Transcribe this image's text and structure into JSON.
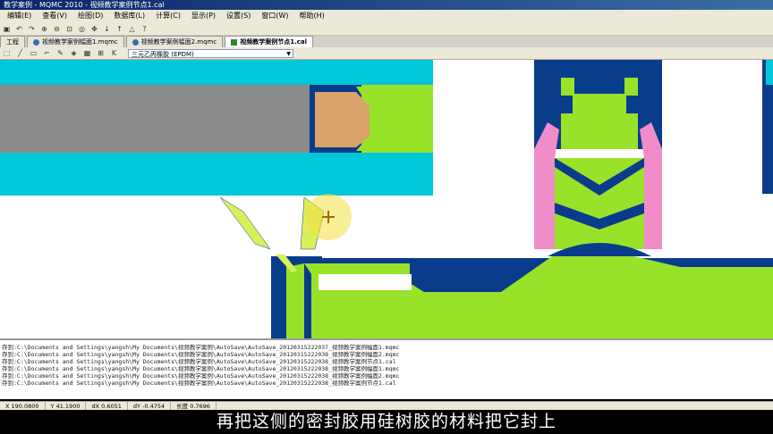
{
  "window": {
    "title": "教学案例 - MQMC 2010 - 视频教学案例节点1.cal"
  },
  "menu": [
    "编辑(E)",
    "查看(V)",
    "绘图(D)",
    "数据库(L)",
    "计算(C)",
    "显示(P)",
    "设置(S)",
    "窗口(W)",
    "帮助(H)"
  ],
  "tabs": [
    {
      "label": "工程"
    },
    {
      "label": "视频教学案例幅面1.mqmc"
    },
    {
      "label": "视频教学案例幅面2.mqmc"
    },
    {
      "label": "视频教学案例节点1.cal"
    }
  ],
  "toolbar2": {
    "key_label": "K",
    "material_select": "三元乙丙橡胶 (EPDM)"
  },
  "log": [
    "存到:C:\\Documents and Settings\\yangsh\\My Documents\\视频教学案例\\AutoSave\\AutoSave_20120315222037_视频教学案例幅面1.mqmc",
    "存到:C:\\Documents and Settings\\yangsh\\My Documents\\视频教学案例\\AutoSave\\AutoSave_20120315222038_视频教学案例幅面2.mqmc",
    "存到:C:\\Documents and Settings\\yangsh\\My Documents\\视频教学案例\\AutoSave\\AutoSave_20120315222038_视频教学案例节点1.cal",
    "存到:C:\\Documents and Settings\\yangsh\\My Documents\\视频教学案例\\AutoSave\\AutoSave_20120315222038_视频教学案例幅面1.mqmc",
    "存到:C:\\Documents and Settings\\yangsh\\My Documents\\视频教学案例\\AutoSave\\AutoSave_20120315222038_视频教学案例幅面2.mqmc",
    "存到:C:\\Documents and Settings\\yangsh\\My Documents\\视频教学案例\\AutoSave\\AutoSave_20120315222038_视频教学案例节点1.cal"
  ],
  "status": {
    "x": "X 190.0800",
    "y": "Y 41.1900",
    "dx": "dX 0.6051",
    "dy": "dY -0.4754",
    "len": "长度 0.7696"
  },
  "caption": "再把这侧的密封胶用硅树胶的材料把它封上",
  "colors": {
    "cyan": "#00c8d8",
    "green": "#99e22a",
    "navy": "#0a3c8c",
    "pink": "#f08cc8",
    "tan": "#d9a46a",
    "gray": "#8a8a8a",
    "yellow": "#d8f05a"
  }
}
